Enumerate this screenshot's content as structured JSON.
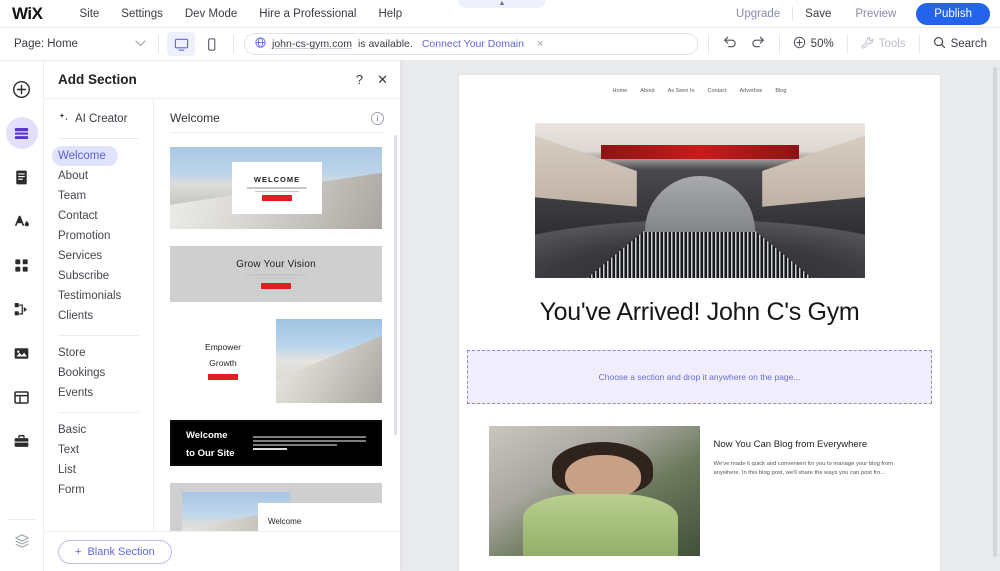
{
  "topbar": {
    "logo": "WiX",
    "menu": [
      "Site",
      "Settings",
      "Dev Mode",
      "Hire a Professional",
      "Help"
    ],
    "upgrade": "Upgrade",
    "save": "Save",
    "preview": "Preview",
    "publish": "Publish"
  },
  "toolbar": {
    "page_label": "Page: Home",
    "domain": {
      "name": "john-cs-gym.com",
      "status": "is available.",
      "link": "Connect Your Domain",
      "close": "×"
    },
    "zoom": "50%",
    "tools": "Tools",
    "search": "Search"
  },
  "rail": {
    "items": [
      {
        "name": "add-icon",
        "label": "Add"
      },
      {
        "name": "add-section-icon",
        "label": "Add Section"
      },
      {
        "name": "pages-icon",
        "label": "Pages"
      },
      {
        "name": "theme-icon",
        "label": "Site Design"
      },
      {
        "name": "apps-icon",
        "label": "App Market"
      },
      {
        "name": "integrations-icon",
        "label": "Integrations"
      },
      {
        "name": "media-icon",
        "label": "Media"
      },
      {
        "name": "cms-icon",
        "label": "Content Manager"
      },
      {
        "name": "business-icon",
        "label": "Business Tools"
      }
    ],
    "bottom": {
      "name": "layers-icon",
      "label": "Layers"
    }
  },
  "panel": {
    "title": "Add Section",
    "help": "?",
    "close": "✕",
    "ai_creator": "AI Creator",
    "categories_group1": [
      "Welcome",
      "About",
      "Team",
      "Contact",
      "Promotion",
      "Services",
      "Subscribe",
      "Testimonials",
      "Clients"
    ],
    "categories_group2": [
      "Store",
      "Bookings",
      "Events"
    ],
    "categories_group3": [
      "Basic",
      "Text",
      "List",
      "Form"
    ],
    "active_category": "Welcome",
    "section_header": "Welcome",
    "info": "i",
    "blank_section": "Blank Section",
    "plus": "+",
    "thumbs": {
      "t1_title": "WELCOME",
      "t2_title": "Grow Your Vision",
      "t3_title": "Empower\nGrowth",
      "t3_line1": "Empower",
      "t3_line2": "Growth",
      "t4_line1": "Welcome",
      "t4_line2": "to Our Site",
      "t5_title": "Welcome"
    }
  },
  "canvas": {
    "site_nav": [
      "Home",
      "About",
      "As Seen In",
      "Contact",
      "Advertise",
      "Blog"
    ],
    "hero_line1": "You've Arrived! John",
    "hero_line2": "C's Gym",
    "drop_zone": "Choose a section and drop it anywhere on the page...",
    "blog_heading": "Now You Can Blog from Everywhere",
    "blog_body": "We've made it quick and convenient for you to manage your blog from anywhere. In this blog post, we'll share the ways you can post fro..."
  },
  "colors": {
    "accent": "#6366d8",
    "publish": "#2463eb",
    "drop_bg": "#f0eefc",
    "active_cat": "#dfe3fd"
  }
}
